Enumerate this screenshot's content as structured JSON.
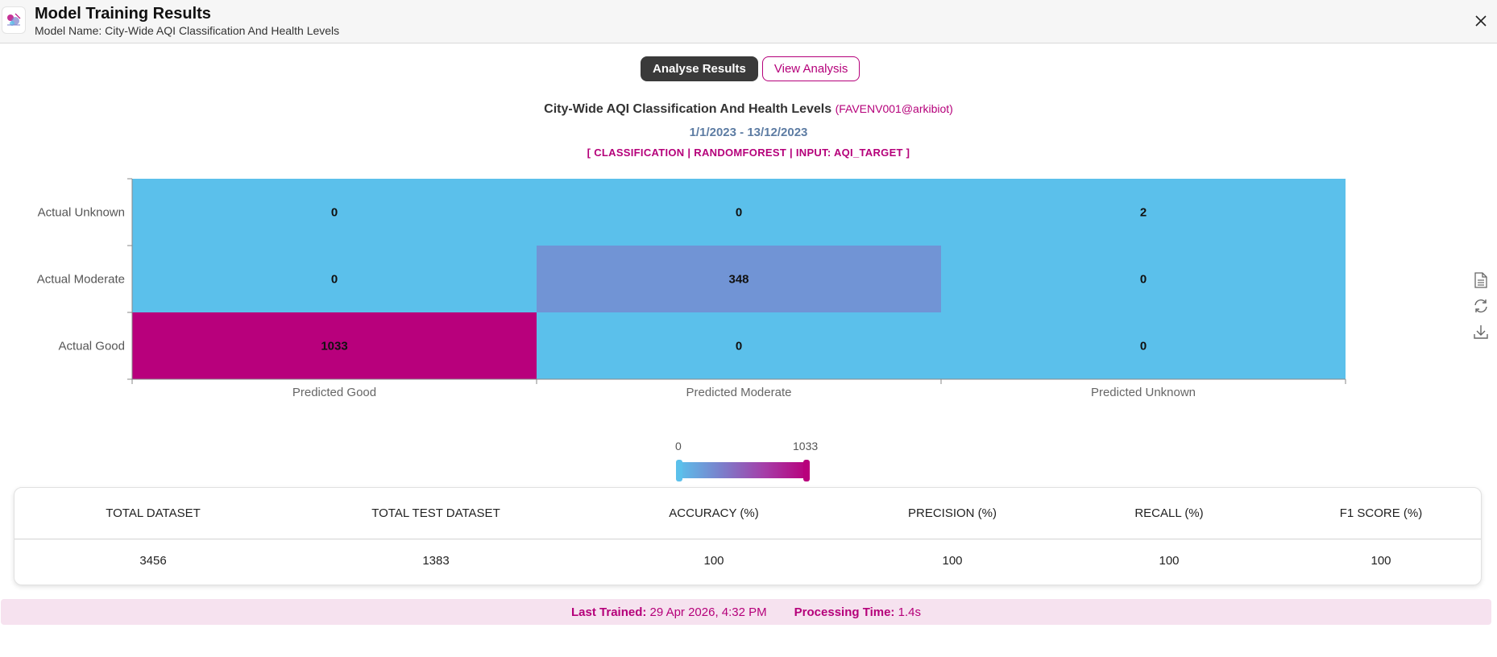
{
  "header": {
    "title": "Model Training Results",
    "subtitle": "Model Name: City-Wide AQI Classification And Health Levels"
  },
  "tabs": [
    {
      "label": "Analyse Results",
      "active": true
    },
    {
      "label": "View Analysis",
      "active": false
    }
  ],
  "chart_header": {
    "title": "City-Wide AQI Classification And Health Levels",
    "owner": "(FAVENV001@arkibiot)",
    "date_range": "1/1/2023 - 13/12/2023",
    "meta": "[ CLASSIFICATION | RANDOMFOREST | INPUT: AQI_TARGET ]"
  },
  "chart_data": {
    "type": "heatmap",
    "x_categories": [
      "Predicted Good",
      "Predicted Moderate",
      "Predicted Unknown"
    ],
    "y_categories": [
      "Actual Unknown",
      "Actual Moderate",
      "Actual Good"
    ],
    "values": [
      [
        0,
        0,
        2
      ],
      [
        0,
        348,
        0
      ],
      [
        1033,
        0,
        0
      ]
    ],
    "color_scale": {
      "min": 0,
      "max": 1033,
      "colors": [
        "#5bc0eb",
        "#7b7fcb",
        "#b8007c"
      ]
    }
  },
  "scale": {
    "min_label": "0",
    "max_label": "1033"
  },
  "metrics": {
    "headers": [
      "TOTAL DATASET",
      "TOTAL TEST DATASET",
      "ACCURACY (%)",
      "PRECISION (%)",
      "RECALL (%)",
      "F1 SCORE (%)"
    ],
    "values": [
      "3456",
      "1383",
      "100",
      "100",
      "100",
      "100"
    ]
  },
  "footer": {
    "last_trained_label": "Last Trained:",
    "last_trained_value": "29 Apr 2026, 4:32 PM",
    "processing_label": "Processing Time:",
    "processing_value": "1.4s"
  },
  "icons": {
    "logo": "app-logo-icon",
    "close": "close-icon",
    "side": [
      "document-icon",
      "refresh-icon",
      "download-icon"
    ]
  },
  "colors": {
    "accent": "#b5007a",
    "dark": "#3a3a3a",
    "date": "#5d7ca3"
  }
}
